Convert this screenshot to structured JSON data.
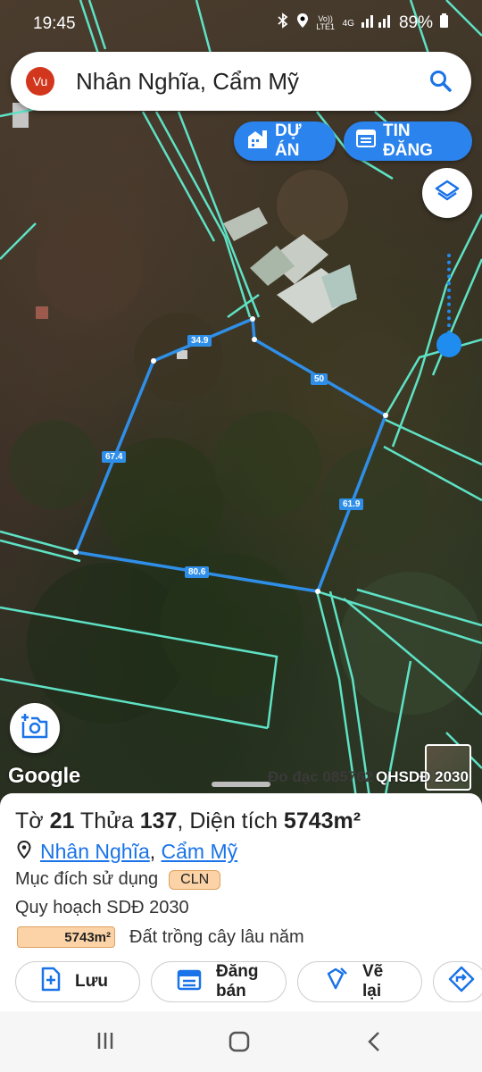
{
  "status_bar": {
    "time": "19:45",
    "network": "Vo)) LTE1",
    "network_type": "4G",
    "battery": "89%"
  },
  "search": {
    "avatar_initials": "Vu",
    "query": "Nhân Nghĩa, Cẩm Mỹ"
  },
  "map_buttons": {
    "du_an_label": "DỰ ÁN",
    "tin_dang_label": "TIN ĐĂNG"
  },
  "map": {
    "google_label": "Google",
    "measure_label": "Đo đạc 085762",
    "plan_label": "QHSDĐ 2030",
    "edge_lengths": [
      "34.9",
      "50",
      "61.9",
      "80.6",
      "67.4"
    ]
  },
  "parcel": {
    "sheet_prefix": "Tờ ",
    "sheet_number": "21",
    "parcel_prefix": " Thửa ",
    "parcel_number": "137",
    "area_prefix": ", Diện tích ",
    "area_value": "5743m²",
    "location_commune": "Nhân Nghĩa",
    "location_separator": ",",
    "location_district": "Cẩm Mỹ",
    "purpose_label": "Mục đích sử dụng",
    "purpose_code": "CLN",
    "plan_label": "Quy hoạch SDĐ 2030",
    "plan_area": "5743m²",
    "plan_description": "Đất trồng cây lâu năm"
  },
  "actions": {
    "save_label": "Lưu",
    "sell_label": "Đăng bán",
    "redraw_label": "Vẽ lại"
  },
  "colors": {
    "accent": "#2b83ee",
    "parcel_line": "#2f8fe8",
    "boundary_line": "#5ee2c5",
    "badge": "#fbd3a6"
  }
}
